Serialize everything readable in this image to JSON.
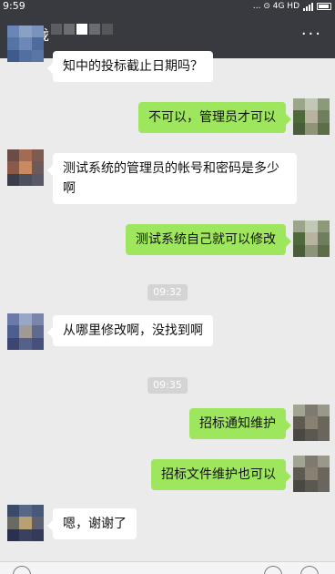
{
  "status": {
    "time": "9:59",
    "icons_text": "... ⊙ 4G HD"
  },
  "header": {
    "title": "栊",
    "more_label": "···"
  },
  "messages": [
    {
      "side": "left",
      "text": "知中的投标截止日期吗？"
    },
    {
      "side": "right",
      "text": "不可以，管理员才可以"
    },
    {
      "side": "left",
      "text": "测试系统的管理员的帐号和密码是多少啊"
    },
    {
      "side": "right",
      "text": "测试系统自己就可以修改"
    },
    {
      "side": "left",
      "text": "从哪里修改啊，没找到啊"
    },
    {
      "side": "right",
      "text": "招标通知维护"
    },
    {
      "side": "right",
      "text": "招标文件维护也可以"
    },
    {
      "side": "left",
      "text": "嗯，谢谢了"
    }
  ],
  "timestamps": [
    "09:32",
    "09:35"
  ],
  "colors": {
    "header_bg": "#393a3f",
    "chat_bg": "#ebebeb",
    "bubble_self": "#9fe65f",
    "bubble_other": "#ffffff"
  }
}
